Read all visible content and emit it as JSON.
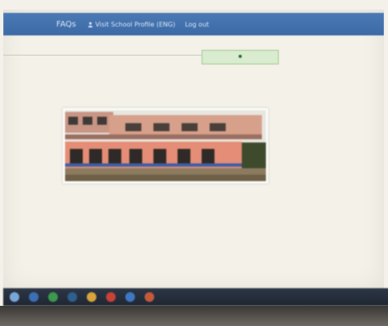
{
  "nav": {
    "faqs_label": "FAQs",
    "visit_label": "Visit School Profile (ENG)",
    "logout_label": "Log out"
  },
  "photo": {
    "subject": "school building"
  },
  "taskbar": {
    "icons": [
      "windows-start-icon",
      "browser-icon",
      "chrome-icon",
      "file-explorer-icon",
      "folder-icon",
      "media-icon",
      "store-icon",
      "app-icon"
    ]
  },
  "colors": {
    "nav_bar": "#3f6fab",
    "screen_bg": "#f3f1e8",
    "upload_box": "#d9eccf",
    "taskbar": "#242c38"
  }
}
